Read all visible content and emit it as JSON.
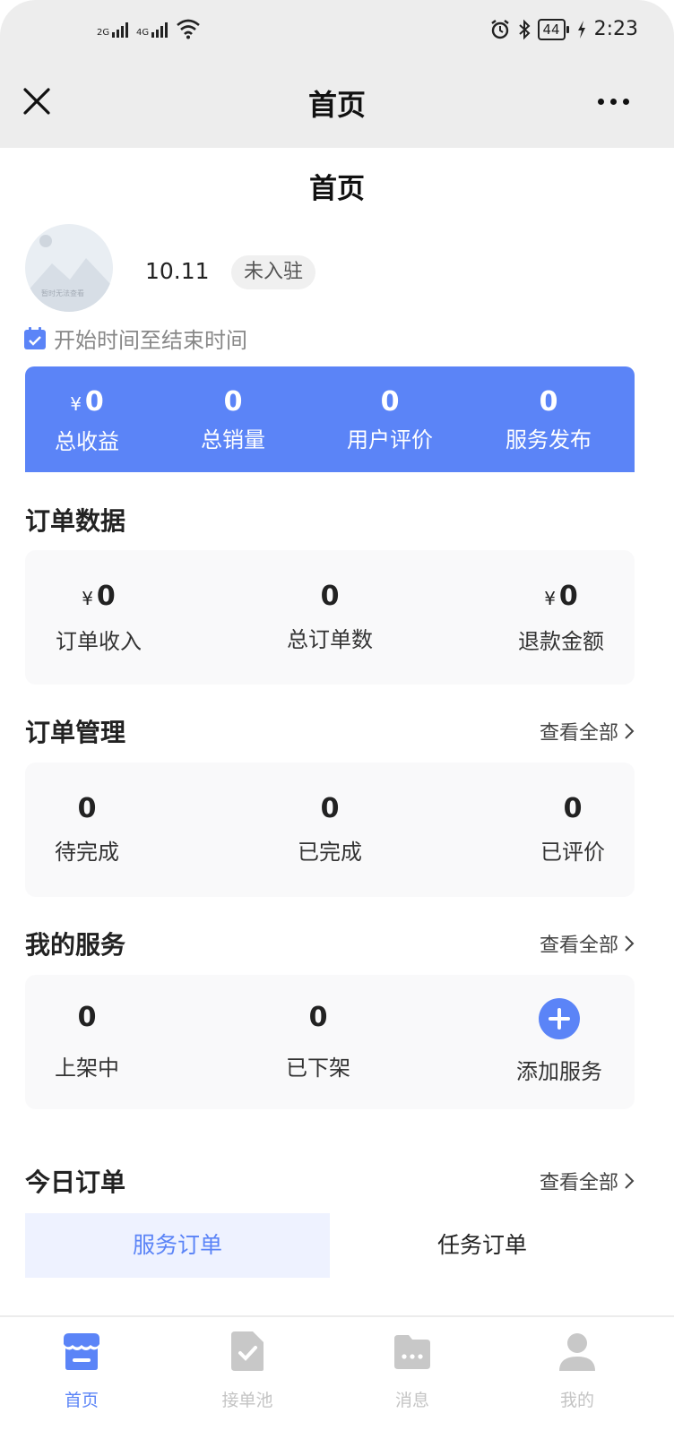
{
  "status_bar": {
    "signal1_label": "2G",
    "signal2_label": "4G",
    "battery": "44",
    "time": "2:23"
  },
  "navbar": {
    "title": "首页"
  },
  "page": {
    "title": "首页"
  },
  "profile": {
    "avatar_text": "暂时无法查看",
    "name": "10.11",
    "status": "未入驻",
    "date_range": "开始时间至结束时间"
  },
  "summary": {
    "items": [
      {
        "currency": "¥",
        "value": "0",
        "label": "总收益"
      },
      {
        "currency": "",
        "value": "0",
        "label": "总销量"
      },
      {
        "currency": "",
        "value": "0",
        "label": "用户评价"
      },
      {
        "currency": "",
        "value": "0",
        "label": "服务发布"
      }
    ]
  },
  "order_data": {
    "title": "订单数据",
    "items": [
      {
        "currency": "¥",
        "value": "0",
        "label": "订单收入"
      },
      {
        "currency": "",
        "value": "0",
        "label": "总订单数"
      },
      {
        "currency": "¥",
        "value": "0",
        "label": "退款金额"
      }
    ]
  },
  "order_mgmt": {
    "title": "订单管理",
    "view_all": "查看全部",
    "items": [
      {
        "value": "0",
        "label": "待完成"
      },
      {
        "value": "0",
        "label": "已完成"
      },
      {
        "value": "0",
        "label": "已评价"
      }
    ]
  },
  "my_services": {
    "title": "我的服务",
    "view_all": "查看全部",
    "items": [
      {
        "value": "0",
        "label": "上架中"
      },
      {
        "value": "0",
        "label": "已下架"
      }
    ],
    "add_label": "添加服务"
  },
  "today_orders": {
    "title": "今日订单",
    "view_all": "查看全部",
    "tabs": [
      {
        "label": "服务订单"
      },
      {
        "label": "任务订单"
      }
    ]
  },
  "bottom_nav": {
    "items": [
      {
        "label": "首页",
        "icon": "store-icon"
      },
      {
        "label": "接单池",
        "icon": "document-check-icon"
      },
      {
        "label": "消息",
        "icon": "message-icon"
      },
      {
        "label": "我的",
        "icon": "user-icon"
      }
    ]
  },
  "colors": {
    "accent": "#5b84f7",
    "inactive": "#c4c4c4"
  }
}
